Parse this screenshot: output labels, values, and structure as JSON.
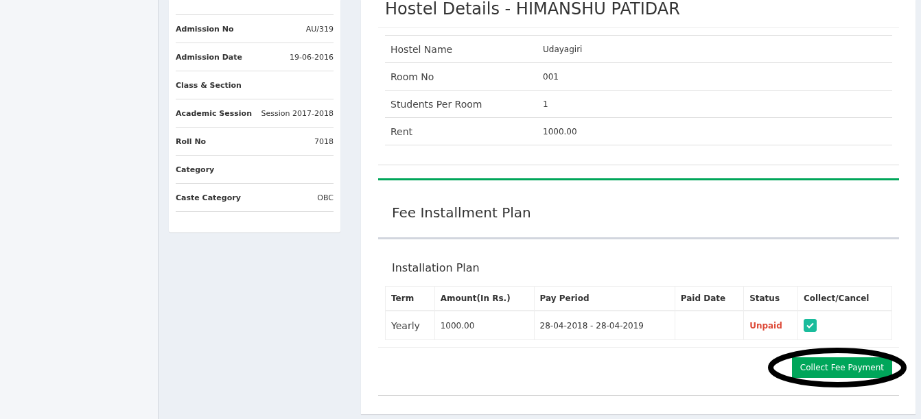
{
  "profile": {
    "rows": [
      {
        "label": "Admission No",
        "value": "AU/319"
      },
      {
        "label": "Admission Date",
        "value": "19-06-2016"
      },
      {
        "label": "Class & Section"
      },
      {
        "label": "Academic Session",
        "value": "Session 2017-2018"
      },
      {
        "label": "Roll No",
        "value": "7018"
      },
      {
        "label": "Category"
      },
      {
        "label": "Caste Category",
        "value": "OBC"
      }
    ]
  },
  "hostel": {
    "title": "Hostel Details - HIMANSHU PATIDAR",
    "rows": [
      {
        "label": "Hostel Name",
        "value": "Udayagiri"
      },
      {
        "label": "Room No",
        "value": "001"
      },
      {
        "label": "Students Per Room",
        "value": "1"
      },
      {
        "label": "Rent",
        "value": "1000.00"
      }
    ]
  },
  "fee_plan": {
    "title": "Fee Installment Plan",
    "subtitle": "Installation Plan",
    "columns": [
      "Term",
      "Amount(In Rs.)",
      "Pay Period",
      "Paid Date",
      "Status",
      "Collect/Cancel"
    ],
    "rows": [
      {
        "term": "Yearly",
        "amount": "1000.00",
        "period": "28-04-2018 - 28-04-2019",
        "status": "Unpaid",
        "paid": false,
        "checked": true
      }
    ],
    "button": {
      "label": "Collect Fee Payment",
      "circled": true
    }
  }
}
